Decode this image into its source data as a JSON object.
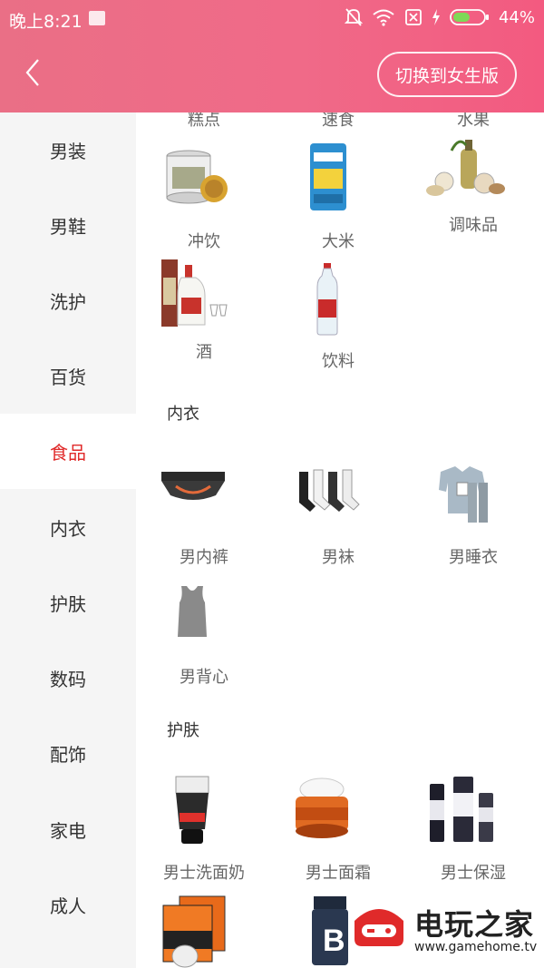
{
  "status": {
    "time": "晚上8:21",
    "battery": "44%"
  },
  "header": {
    "switch_label": "切换到女生版"
  },
  "sidebar": {
    "items": [
      {
        "label": "男装"
      },
      {
        "label": "男鞋"
      },
      {
        "label": "洗护"
      },
      {
        "label": "百货"
      },
      {
        "label": "食品"
      },
      {
        "label": "内衣"
      },
      {
        "label": "护肤"
      },
      {
        "label": "数码"
      },
      {
        "label": "配饰"
      },
      {
        "label": "家电"
      },
      {
        "label": "成人"
      }
    ],
    "active": "食品"
  },
  "food": {
    "partial_labels": [
      "糕点",
      "速食",
      "水果"
    ],
    "items": [
      {
        "label": "冲饮",
        "icon": "canister-icon"
      },
      {
        "label": "大米",
        "icon": "rice-bag-icon"
      },
      {
        "label": "调味品",
        "icon": "seasoning-icon"
      },
      {
        "label": "酒",
        "icon": "liquor-icon"
      },
      {
        "label": "饮料",
        "icon": "water-bottle-icon"
      }
    ]
  },
  "underwear": {
    "title": "内衣",
    "items": [
      {
        "label": "男内裤",
        "icon": "briefs-icon"
      },
      {
        "label": "男袜",
        "icon": "socks-icon"
      },
      {
        "label": "男睡衣",
        "icon": "pajamas-icon"
      },
      {
        "label": "男背心",
        "icon": "tank-top-icon"
      }
    ]
  },
  "skincare": {
    "title": "护肤",
    "items": [
      {
        "label": "男士洗面奶",
        "icon": "face-wash-icon"
      },
      {
        "label": "男士面霜",
        "icon": "face-cream-icon"
      },
      {
        "label": "男士保湿",
        "icon": "moisturizer-set-icon"
      }
    ]
  },
  "watermark": {
    "text": "电玩之家",
    "url": "www.gamehome.tv"
  },
  "colors": {
    "accent": "#e02a2a",
    "header": "#f06a88",
    "sidebar_bg": "#f5f5f5"
  }
}
